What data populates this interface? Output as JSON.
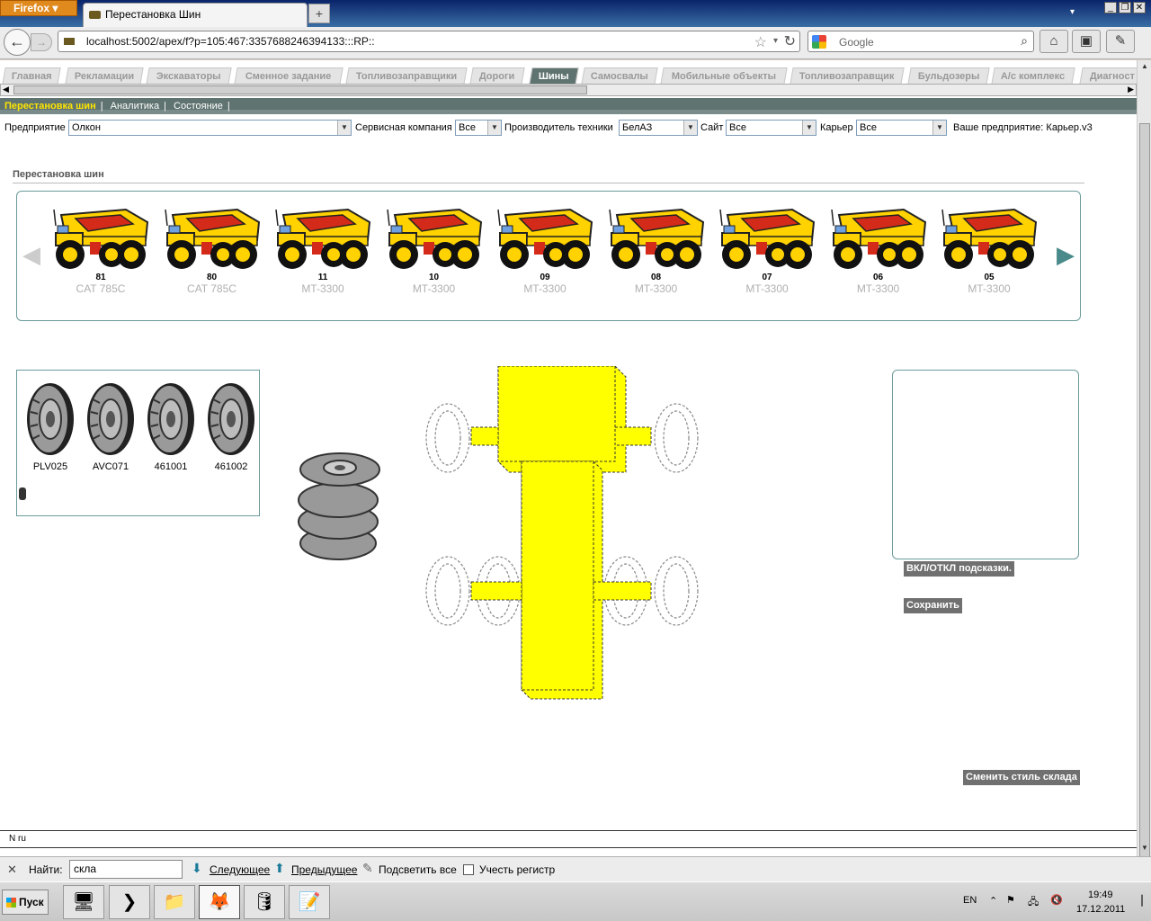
{
  "browser": {
    "app_button": "Firefox",
    "tab_title": "Перестановка Шин",
    "url": "localhost:5002/apex/f?p=105:467:3357688246394133:::RP::",
    "search_engine": "Google",
    "new_tab_symbol": "+"
  },
  "app_tabs": [
    "Главная",
    "Рекламации",
    "Экскаваторы",
    "Сменное задание",
    "Топливозаправщики",
    "Дороги",
    "Шины",
    "Самосвалы",
    "Мобильные объекты",
    "Топливозаправщик",
    "Бульдозеры",
    "А/с комплекс",
    "Диагност"
  ],
  "active_tab": "Шины",
  "subnav": {
    "items": [
      "Перестановка шин",
      "Аналитика",
      "Состояние"
    ],
    "active": "Перестановка шин"
  },
  "filters": {
    "enterprise_label": "Предприятие",
    "enterprise_value": "Олкон",
    "service_label": "Сервисная компания",
    "service_value": "Все",
    "maker_label": "Производитель техники",
    "maker_value": "БелАЗ",
    "site_label": "Сайт",
    "site_value": "Все",
    "quarry_label": "Карьер",
    "quarry_value": "Все",
    "your_enterprise": "Ваше предприятие: Карьер.v3"
  },
  "region_title": "Перестановка шин",
  "trucks": [
    {
      "num": "81",
      "model": "CAT 785C"
    },
    {
      "num": "80",
      "model": "CAT 785C"
    },
    {
      "num": "11",
      "model": "MT-3300"
    },
    {
      "num": "10",
      "model": "MT-3300"
    },
    {
      "num": "09",
      "model": "MT-3300"
    },
    {
      "num": "08",
      "model": "MT-3300"
    },
    {
      "num": "07",
      "model": "MT-3300"
    },
    {
      "num": "06",
      "model": "MT-3300"
    },
    {
      "num": "05",
      "model": "MT-3300"
    }
  ],
  "tires": [
    "PLV025",
    "AVC071",
    "461001",
    "461002"
  ],
  "buttons": {
    "hints_toggle": "ВКЛ/ОТКЛ подсказки.",
    "save": "Сохранить",
    "change_style": "Сменить стиль склада"
  },
  "status_line": "N   ru",
  "findbar": {
    "label": "Найти:",
    "value": "скла",
    "next": "Следующее",
    "prev": "Предыдущее",
    "highlight": "Подсветить все",
    "match_case": "Учесть регистр"
  },
  "taskbar": {
    "start": "Пуск",
    "lang": "EN",
    "time": "19:49",
    "date": "17.12.2011"
  },
  "colors": {
    "accent": "#5f7370",
    "chassis": "#ffff00",
    "active_subnav": "#ffe500"
  }
}
